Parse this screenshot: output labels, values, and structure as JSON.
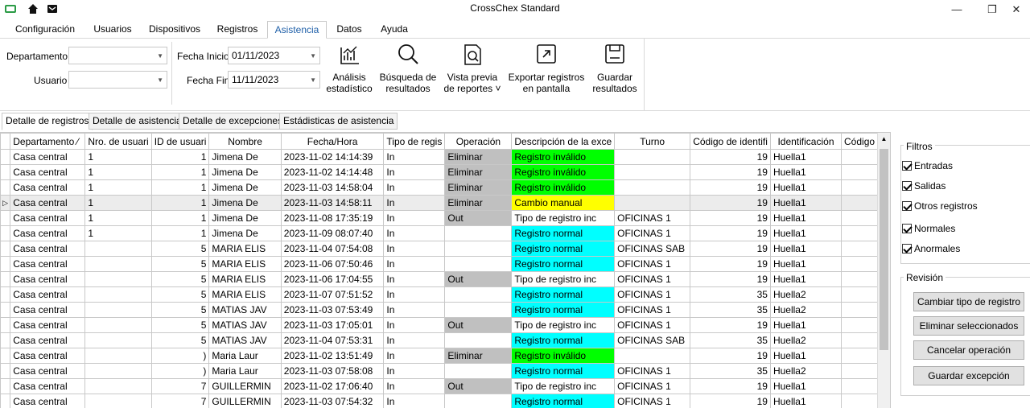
{
  "window": {
    "title": "CrossChex Standard",
    "minimize": "—",
    "maximize": "❐",
    "close": "✕"
  },
  "menu": [
    "Configuración",
    "Usuarios",
    "Dispositivos",
    "Registros",
    "Asistencia",
    "Datos",
    "Ayuda"
  ],
  "ribbon": {
    "departamento_label": "Departamento",
    "usuario_label": "Usuario",
    "fecha_inicio_label": "Fecha Inicio",
    "fecha_inicio_value": "01/11/2023",
    "fecha_fin_label": "Fecha Fin",
    "fecha_fin_value": "11/11/2023",
    "buttons": [
      {
        "line1": "Análisis",
        "line2": "estadístico",
        "icon": "chart-icon"
      },
      {
        "line1": "Búsqueda de",
        "line2": "resultados",
        "icon": "search-icon"
      },
      {
        "line1": "Vista previa",
        "line2": "de reportes ˅",
        "icon": "preview-icon"
      },
      {
        "line1": "Exportar registros",
        "line2": "en pantalla",
        "icon": "export-icon"
      },
      {
        "line1": "Guardar",
        "line2": "resultados",
        "icon": "save-icon"
      }
    ]
  },
  "subtabs": [
    "Detalle de registros",
    "Detalle de asistencia",
    "Detalle de excepciones",
    "Estádisticas de asistencia"
  ],
  "table": {
    "headers": [
      "Departamento",
      "Nro. de usuari",
      "ID de usuari",
      "Nombre",
      "Fecha/Hora",
      "Tipo de regis",
      "Operación",
      "Descripción de la exce",
      "Turno",
      "Código de identifi",
      "Identificación",
      "Código d"
    ],
    "rows": [
      {
        "dep": "Casa central",
        "nro": "1",
        "id": "1",
        "nombre": "Jimena De",
        "fecha": "2023-11-02 14:14:39",
        "tipo": "In",
        "op": "Eliminar",
        "desc": "Registro inválido",
        "turno": "",
        "cod": "19",
        "ident": "Huella1",
        "opc": "gray",
        "descc": "green"
      },
      {
        "dep": "Casa central",
        "nro": "1",
        "id": "1",
        "nombre": "Jimena De",
        "fecha": "2023-11-02 14:14:48",
        "tipo": "In",
        "op": "Eliminar",
        "desc": "Registro inválido",
        "turno": "",
        "cod": "19",
        "ident": "Huella1",
        "opc": "gray",
        "descc": "green"
      },
      {
        "dep": "Casa central",
        "nro": "1",
        "id": "1",
        "nombre": "Jimena De",
        "fecha": "2023-11-03 14:58:04",
        "tipo": "In",
        "op": "Eliminar",
        "desc": "Registro inválido",
        "turno": "",
        "cod": "19",
        "ident": "Huella1",
        "opc": "gray",
        "descc": "green"
      },
      {
        "dep": "Casa central",
        "nro": "1",
        "id": "1",
        "nombre": "Jimena De",
        "fecha": "2023-11-03 14:58:11",
        "tipo": "In",
        "op": "Eliminar",
        "desc": "Cambio manual",
        "turno": "",
        "cod": "19",
        "ident": "Huella1",
        "opc": "gray",
        "descc": "yellow",
        "sel": true
      },
      {
        "dep": "Casa central",
        "nro": "1",
        "id": "1",
        "nombre": "Jimena De",
        "fecha": "2023-11-08 17:35:19",
        "tipo": "In",
        "op": "Out",
        "desc": "Tipo de registro inc",
        "turno": "OFICINAS 1",
        "cod": "19",
        "ident": "Huella1",
        "opc": "gray",
        "descc": ""
      },
      {
        "dep": "Casa central",
        "nro": "1",
        "id": "1",
        "nombre": "Jimena De",
        "fecha": "2023-11-09 08:07:40",
        "tipo": "In",
        "op": "",
        "desc": "Registro normal",
        "turno": "OFICINAS 1",
        "cod": "19",
        "ident": "Huella1",
        "opc": "",
        "descc": "cyan"
      },
      {
        "dep": "Casa central",
        "nro": "",
        "id": "5",
        "nombre": "MARIA ELIS",
        "fecha": "2023-11-04 07:54:08",
        "tipo": "In",
        "op": "",
        "desc": "Registro normal",
        "turno": "OFICINAS SAB",
        "cod": "19",
        "ident": "Huella1",
        "opc": "",
        "descc": "cyan"
      },
      {
        "dep": "Casa central",
        "nro": "",
        "id": "5",
        "nombre": "MARIA ELIS",
        "fecha": "2023-11-06 07:50:46",
        "tipo": "In",
        "op": "",
        "desc": "Registro normal",
        "turno": "OFICINAS 1",
        "cod": "19",
        "ident": "Huella1",
        "opc": "",
        "descc": "cyan"
      },
      {
        "dep": "Casa central",
        "nro": "",
        "id": "5",
        "nombre": "MARIA ELIS",
        "fecha": "2023-11-06 17:04:55",
        "tipo": "In",
        "op": "Out",
        "desc": "Tipo de registro inc",
        "turno": "OFICINAS 1",
        "cod": "19",
        "ident": "Huella1",
        "opc": "gray",
        "descc": ""
      },
      {
        "dep": "Casa central",
        "nro": "",
        "id": "5",
        "nombre": "MARIA ELIS",
        "fecha": "2023-11-07 07:51:52",
        "tipo": "In",
        "op": "",
        "desc": "Registro normal",
        "turno": "OFICINAS 1",
        "cod": "35",
        "ident": "Huella2",
        "opc": "",
        "descc": "cyan"
      },
      {
        "dep": "Casa central",
        "nro": "",
        "id": "5",
        "nombre": "MATIAS JAV",
        "fecha": "2023-11-03 07:53:49",
        "tipo": "In",
        "op": "",
        "desc": "Registro normal",
        "turno": "OFICINAS 1",
        "cod": "35",
        "ident": "Huella2",
        "opc": "",
        "descc": "cyan"
      },
      {
        "dep": "Casa central",
        "nro": "",
        "id": "5",
        "nombre": "MATIAS JAV",
        "fecha": "2023-11-03 17:05:01",
        "tipo": "In",
        "op": "Out",
        "desc": "Tipo de registro inc",
        "turno": "OFICINAS 1",
        "cod": "19",
        "ident": "Huella1",
        "opc": "gray",
        "descc": ""
      },
      {
        "dep": "Casa central",
        "nro": "",
        "id": "5",
        "nombre": "MATIAS JAV",
        "fecha": "2023-11-04 07:53:31",
        "tipo": "In",
        "op": "",
        "desc": "Registro normal",
        "turno": "OFICINAS SAB",
        "cod": "35",
        "ident": "Huella2",
        "opc": "",
        "descc": "cyan"
      },
      {
        "dep": "Casa central",
        "nro": "",
        "id": ")",
        "nombre": "Maria Laur",
        "fecha": "2023-11-02 13:51:49",
        "tipo": "In",
        "op": "Eliminar",
        "desc": "Registro inválido",
        "turno": "",
        "cod": "19",
        "ident": "Huella1",
        "opc": "gray",
        "descc": "green"
      },
      {
        "dep": "Casa central",
        "nro": "",
        "id": ")",
        "nombre": "Maria Laur",
        "fecha": "2023-11-03 07:58:08",
        "tipo": "In",
        "op": "",
        "desc": "Registro normal",
        "turno": "OFICINAS 1",
        "cod": "35",
        "ident": "Huella2",
        "opc": "",
        "descc": "cyan"
      },
      {
        "dep": "Casa central",
        "nro": "",
        "id": "7",
        "nombre": "GUILLERMIN",
        "fecha": "2023-11-02 17:06:40",
        "tipo": "In",
        "op": "Out",
        "desc": "Tipo de registro inc",
        "turno": "OFICINAS 1",
        "cod": "19",
        "ident": "Huella1",
        "opc": "gray",
        "descc": ""
      },
      {
        "dep": "Casa central",
        "nro": "",
        "id": "7",
        "nombre": "GUILLERMIN",
        "fecha": "2023-11-03 07:54:32",
        "tipo": "In",
        "op": "",
        "desc": "Registro normal",
        "turno": "OFICINAS 1",
        "cod": "19",
        "ident": "Huella1",
        "opc": "",
        "descc": "cyan"
      }
    ]
  },
  "filters": {
    "title": "Filtros",
    "items": [
      "Entradas",
      "Salidas",
      "Otros registros",
      "Normales",
      "Anormales"
    ]
  },
  "revision": {
    "title": "Revisión",
    "buttons": [
      "Cambiar tipo de registro",
      "Eliminar seleccionados",
      "Cancelar operación",
      "Guardar excepción"
    ]
  },
  "colors": {
    "gray": "#c0c0c0",
    "green": "#00ff00",
    "yellow": "#ffff00",
    "cyan": "#00ffff",
    "accent": "#1e5fa8"
  }
}
